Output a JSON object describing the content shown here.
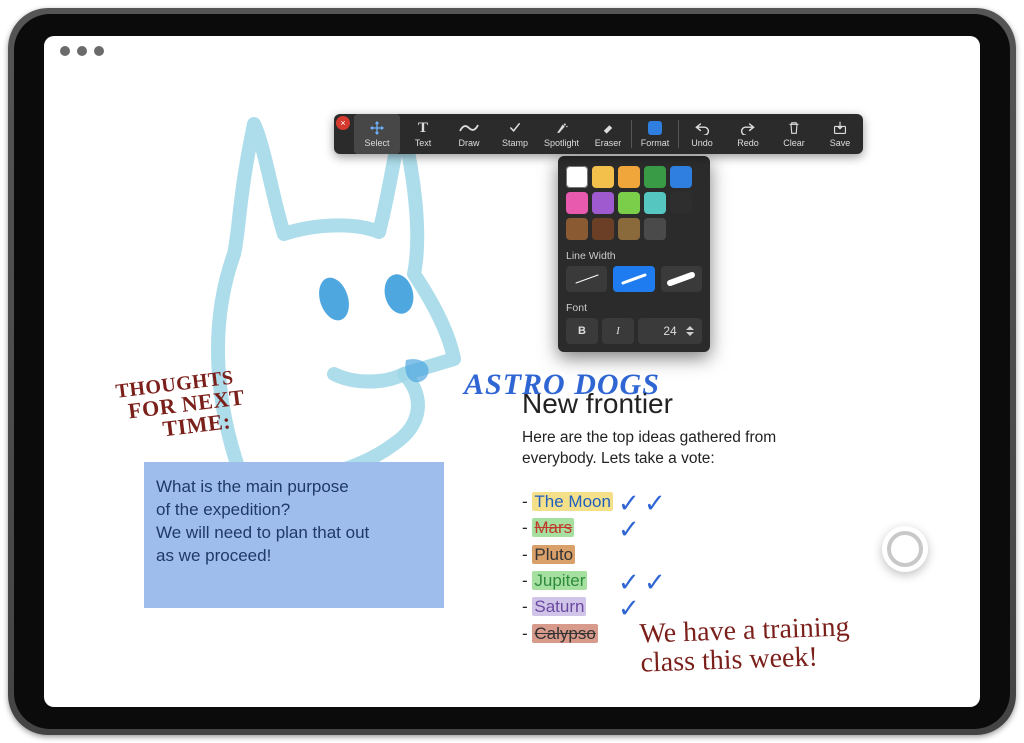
{
  "toolbar": {
    "close_glyph": "×",
    "items": [
      {
        "id": "select",
        "label": "Select",
        "icon": "move-icon",
        "selected": true
      },
      {
        "id": "text",
        "label": "Text",
        "icon": "text-icon"
      },
      {
        "id": "draw",
        "label": "Draw",
        "icon": "draw-icon"
      },
      {
        "id": "stamp",
        "label": "Stamp",
        "icon": "stamp-icon"
      },
      {
        "id": "spotlight",
        "label": "Spotlight",
        "icon": "spotlight-icon"
      },
      {
        "id": "eraser",
        "label": "Eraser",
        "icon": "eraser-icon"
      },
      {
        "id": "format_sep",
        "sep": true
      },
      {
        "id": "format",
        "label": "Format",
        "icon": "format-icon"
      },
      {
        "id": "undo_sep",
        "sep": true
      },
      {
        "id": "undo",
        "label": "Undo",
        "icon": "undo-icon"
      },
      {
        "id": "redo",
        "label": "Redo",
        "icon": "redo-icon"
      },
      {
        "id": "clear",
        "label": "Clear",
        "icon": "clear-icon"
      },
      {
        "id": "save",
        "label": "Save",
        "icon": "save-icon"
      }
    ]
  },
  "format_panel": {
    "swatches": [
      "#ffffff",
      "#f2c04b",
      "#f0a63a",
      "#3a9b47",
      "#2f7fe0",
      "#e85aad",
      "#a05ad0",
      "#7bce4a",
      "#56c6c0",
      "#2e2e2e",
      "#8a5a32",
      "#6b3f25",
      "#8a6a3a",
      "#4a4a4a"
    ],
    "line_width_label": "Line Width",
    "widths": [
      {
        "px": 1
      },
      {
        "px": 3,
        "selected": true
      },
      {
        "px": 6
      }
    ],
    "font_label": "Font",
    "bold_glyph": "B",
    "italic_glyph": "I",
    "font_size": "24"
  },
  "handwriting": {
    "thoughts": [
      "THOUGHTS",
      "FOR NEXT",
      "TIME:"
    ],
    "astro": "ASTRO DOGS",
    "training": [
      "We have a training",
      "class this week!"
    ]
  },
  "bluebox": {
    "line1": "What is the main purpose",
    "line2": "of the expedition?",
    "line3": "We will need to plan that out",
    "line4": "as we proceed!"
  },
  "document": {
    "subtitle": "New frontier",
    "paragraph": "Here are the top ideas gathered from everybody. Lets take a vote:",
    "options": [
      {
        "name": "The Moon",
        "color": "col-bl",
        "hl": "hl-yel",
        "checks": 2
      },
      {
        "name": "Mars",
        "color": "col-rd",
        "hl": "hl-grn",
        "checks": 1
      },
      {
        "name": "Pluto",
        "color": "col-dk",
        "hl": "hl-or",
        "checks": 0
      },
      {
        "name": "Jupiter",
        "color": "col-gr",
        "hl": "hl-lgrn",
        "checks": 2
      },
      {
        "name": "Saturn",
        "color": "col-pu",
        "hl": "hl-lil",
        "checks": 1
      },
      {
        "name": "Calypso",
        "color": "col-dk",
        "hl": "hl-red",
        "checks": 0
      }
    ]
  }
}
